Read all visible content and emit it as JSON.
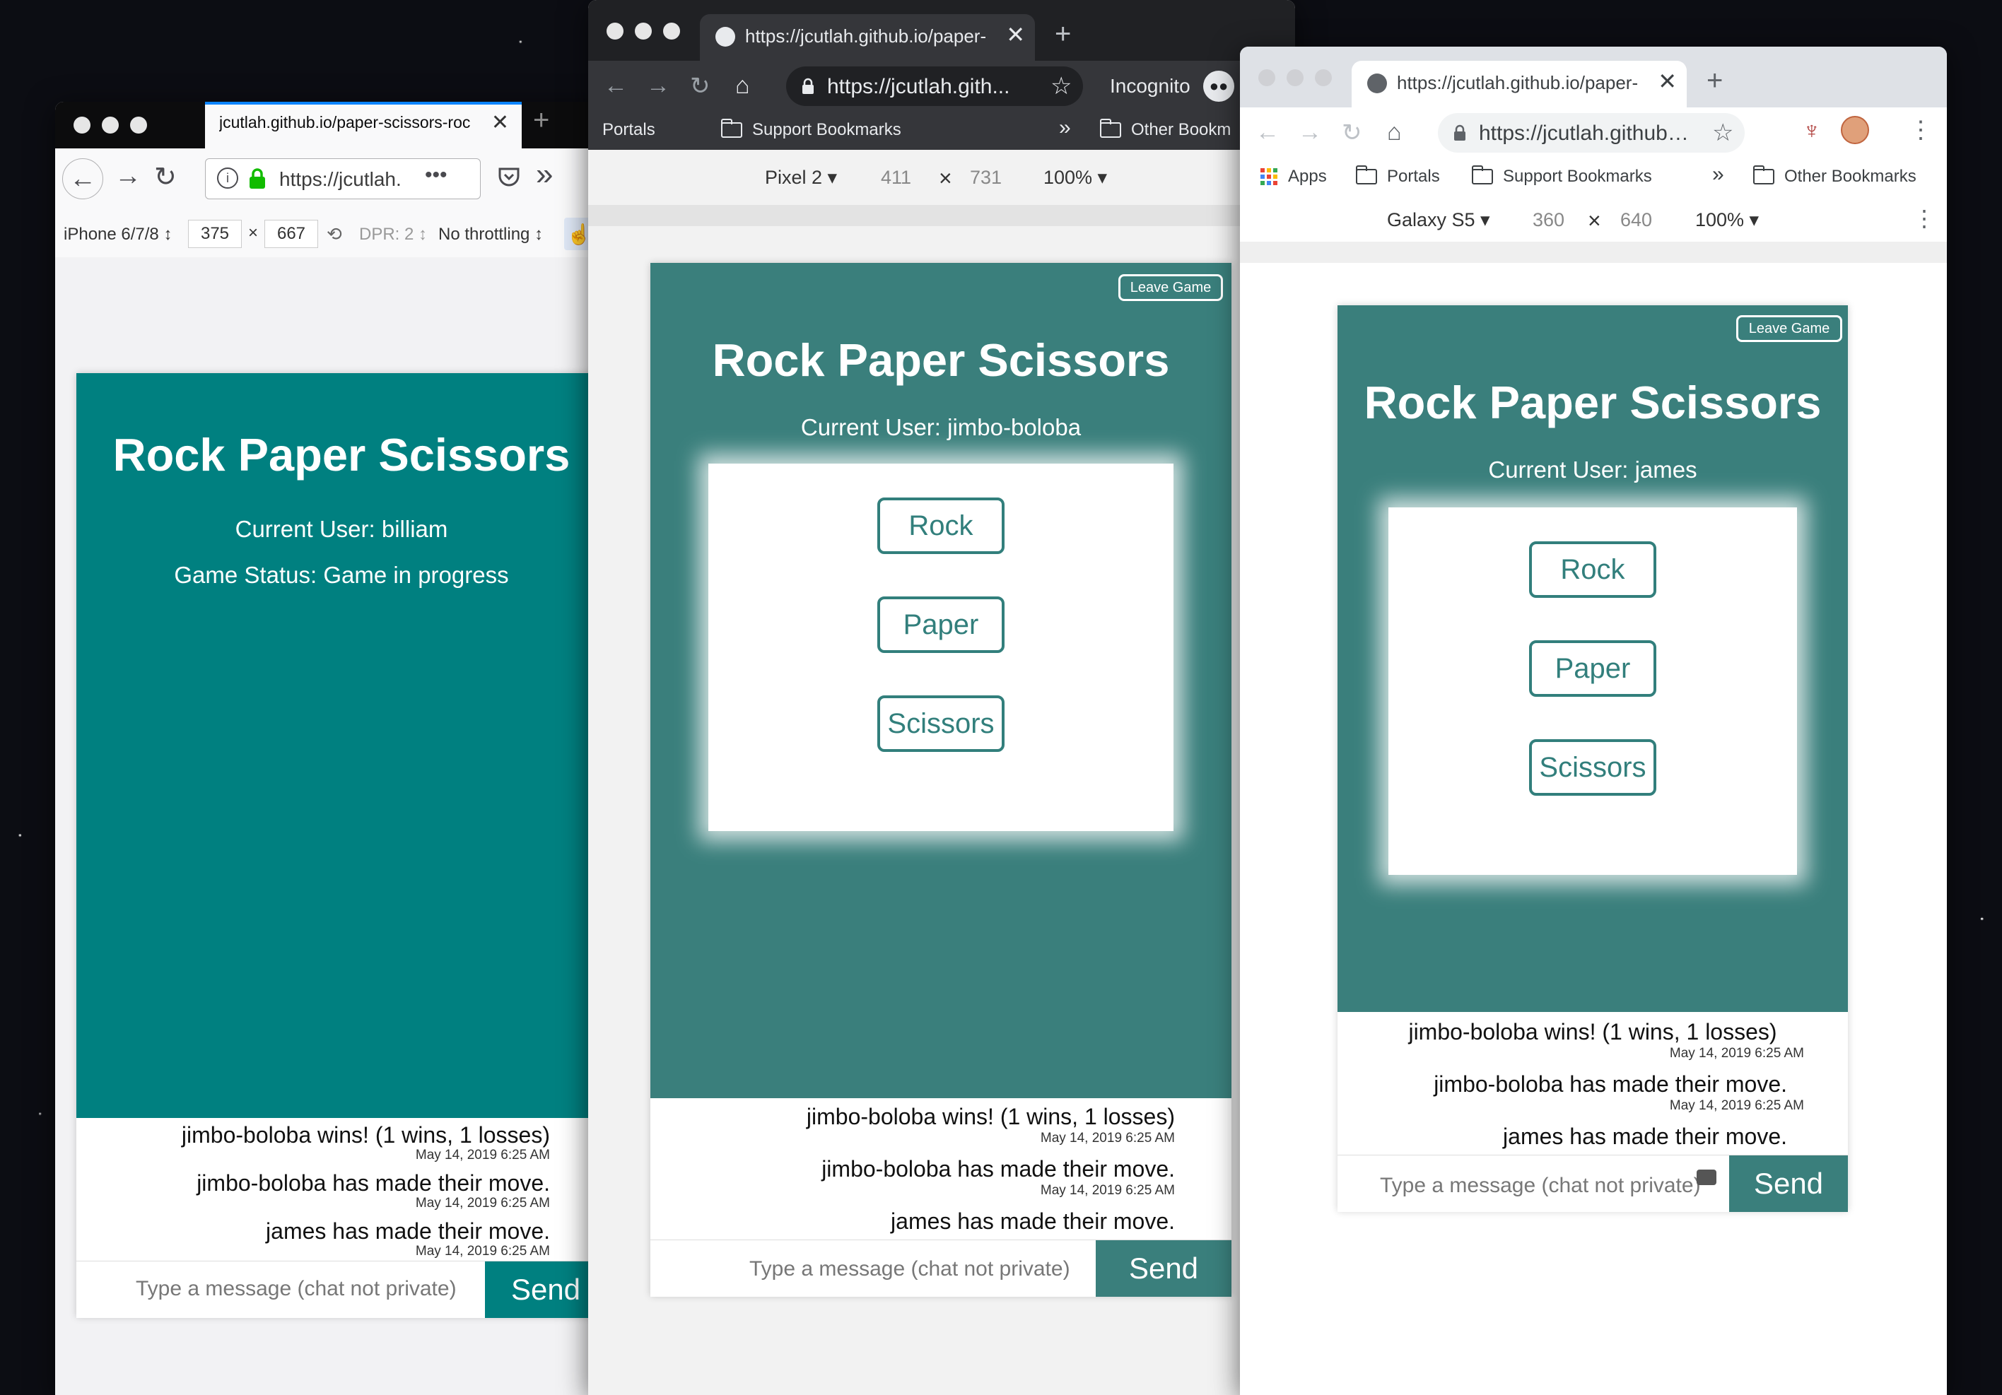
{
  "firefox": {
    "tab_title": "jcutlah.github.io/paper-scissors-roc",
    "url_text": "https://jcutlah.",
    "device": "iPhone 6/7/8 ↕",
    "width": "375",
    "times": "×",
    "height": "667",
    "dpr": "DPR: 2 ↕",
    "throttling": "No throttling ↕",
    "app": {
      "title": "Rock Paper Scissors",
      "current_user": "Current User: billiam",
      "game_status": "Game Status: Game in progress",
      "messages": [
        {
          "text": "jimbo-boloba wins! (1 wins, 1 losses)",
          "time": "May 14, 2019 6:25 AM"
        },
        {
          "text": "jimbo-boloba has made their move.",
          "time": "May 14, 2019 6:25 AM"
        },
        {
          "text": "james has made their move.",
          "time": "May 14, 2019 6:25 AM"
        }
      ],
      "input_placeholder": "Type a message (chat not private)",
      "send": "Send"
    }
  },
  "chrome_incognito": {
    "tab_title": "https://jcutlah.github.io/paper-",
    "url_text": "https://jcutlah.gith...",
    "incognito_label": "Incognito",
    "bookmarks": [
      "Portals",
      "Support Bookmarks",
      "»",
      "Other Bookm"
    ],
    "device": "Pixel 2 ▾",
    "width": "411",
    "times": "×",
    "height": "731",
    "zoom": "100% ▾",
    "app": {
      "leave": "Leave Game",
      "title": "Rock Paper Scissors",
      "current_user": "Current User: jimbo-boloba",
      "buttons": [
        "Rock",
        "Paper",
        "Scissors"
      ],
      "messages": [
        {
          "text": "jimbo-boloba wins! (1 wins, 1 losses)",
          "time": "May 14, 2019 6:25 AM"
        },
        {
          "text": "jimbo-boloba has made their move.",
          "time": "May 14, 2019 6:25 AM"
        },
        {
          "text": "james has made their move.",
          "time": ""
        }
      ],
      "input_placeholder": "Type a message (chat not private)",
      "send": "Send"
    }
  },
  "chrome": {
    "tab_title": "https://jcutlah.github.io/paper-",
    "url_text": "https://jcutlah.github.i...",
    "bookmarks": [
      "Apps",
      "Portals",
      "Support Bookmarks",
      "»",
      "Other Bookmarks"
    ],
    "device": "Galaxy S5 ▾",
    "width": "360",
    "times": "×",
    "height": "640",
    "zoom": "100% ▾",
    "app": {
      "leave": "Leave Game",
      "title": "Rock Paper Scissors",
      "current_user": "Current User: james",
      "buttons": [
        "Rock",
        "Paper",
        "Scissors"
      ],
      "messages": [
        {
          "text": "jimbo-boloba wins! (1 wins, 1 losses)",
          "time": "May 14, 2019 6:25 AM"
        },
        {
          "text": "jimbo-boloba has made their move.",
          "time": "May 14, 2019 6:25 AM"
        },
        {
          "text": "james has made their move.",
          "time": ""
        }
      ],
      "input_placeholder": "Type a message (chat not private)",
      "send": "Send"
    }
  },
  "colors": {
    "firefox_hero": "#008080",
    "chrome_hero": "#3a7f7c",
    "button_border": "#327f7c",
    "firefox_accent": "#0a84ff"
  }
}
